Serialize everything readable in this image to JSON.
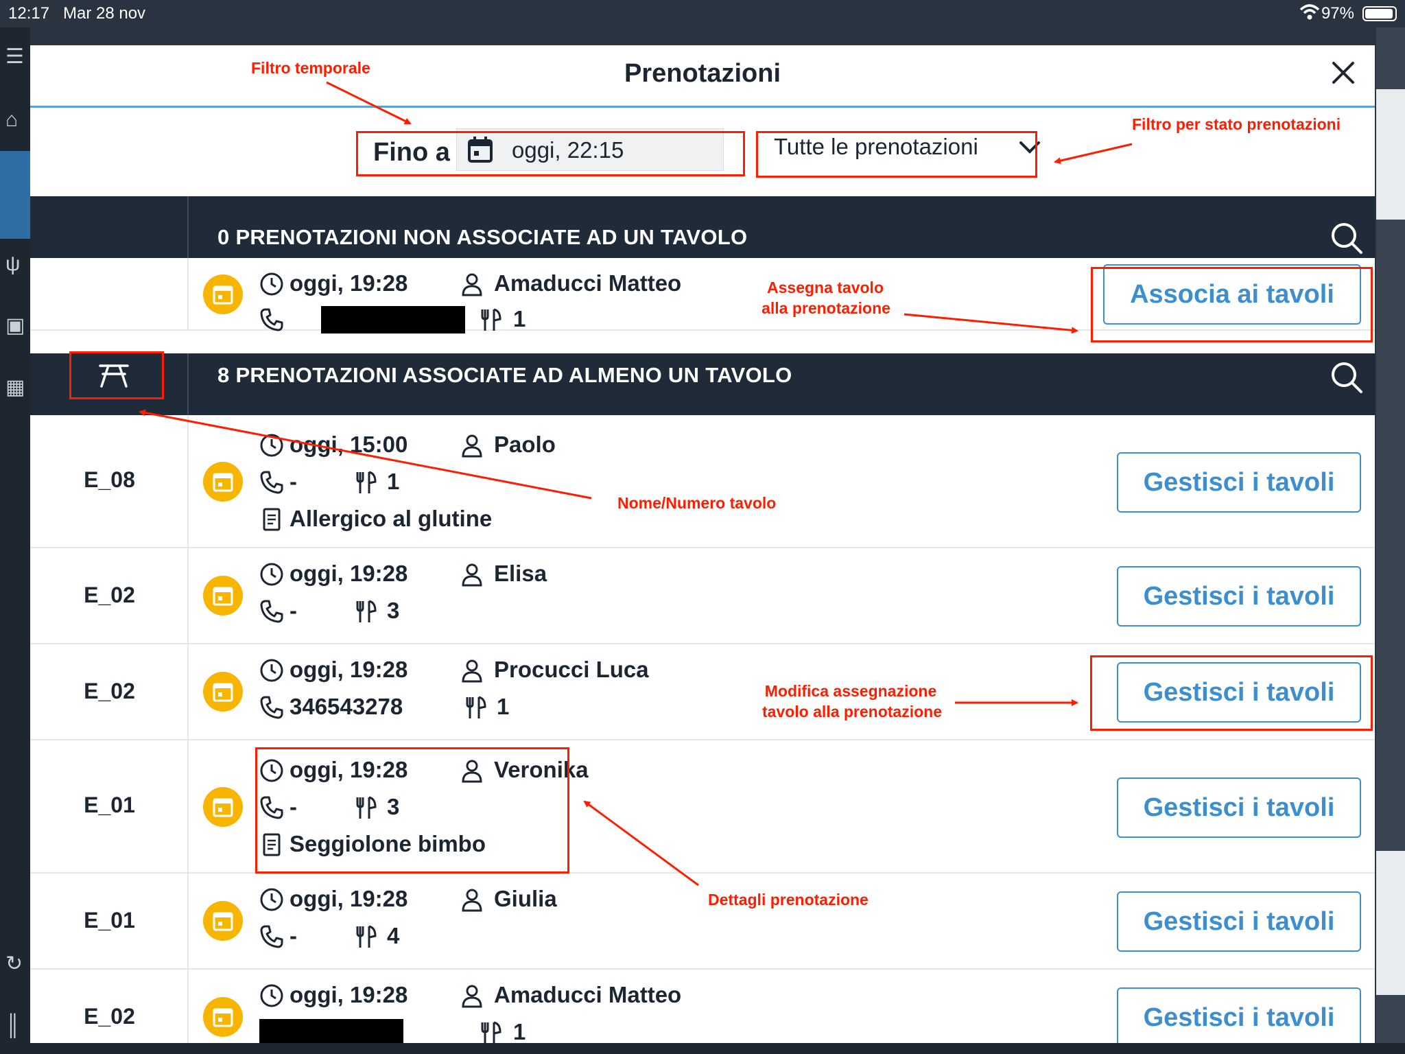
{
  "status_bar": {
    "time": "12:17",
    "date": "Mar 28 nov",
    "battery": "97%"
  },
  "modal": {
    "title": "Prenotazioni"
  },
  "filters": {
    "until_label": "Fino a",
    "date_value": "oggi, 22:15",
    "status_value": "Tutte le prenotazioni"
  },
  "sections": {
    "unassigned_title": "0 PRENOTAZIONI NON ASSOCIATE AD UN TAVOLO",
    "assigned_title": "8 PRENOTAZIONI ASSOCIATE AD ALMENO UN TAVOLO"
  },
  "unassigned": [
    {
      "time": "oggi, 19:28",
      "name": "Amaducci Matteo",
      "phone": "",
      "covers": "1",
      "button": "Associa ai tavoli"
    }
  ],
  "assigned": [
    {
      "table": "E_08",
      "time": "oggi, 15:00",
      "name": "Paolo",
      "phone": "-",
      "covers": "1",
      "note": "Allergico al glutine",
      "button": "Gestisci i tavoli"
    },
    {
      "table": "E_02",
      "time": "oggi, 19:28",
      "name": "Elisa",
      "phone": "-",
      "covers": "3",
      "note": "",
      "button": "Gestisci i tavoli"
    },
    {
      "table": "E_02",
      "time": "oggi, 19:28",
      "name": "Procucci Luca",
      "phone": "346543278",
      "covers": "1",
      "note": "",
      "button": "Gestisci i tavoli"
    },
    {
      "table": "E_01",
      "time": "oggi, 19:28",
      "name": "Veronika",
      "phone": "-",
      "covers": "3",
      "note": "Seggiolone bimbo",
      "button": "Gestisci i tavoli"
    },
    {
      "table": "E_01",
      "time": "oggi, 19:28",
      "name": "Giulia",
      "phone": "-",
      "covers": "4",
      "note": "",
      "button": "Gestisci i tavoli"
    },
    {
      "table": "E_02",
      "time": "oggi, 19:28",
      "name": "Amaducci Matteo",
      "phone": "",
      "covers": "1",
      "note": "",
      "button": "Gestisci i tavoli"
    }
  ],
  "annotations": {
    "time_filter": "Filtro temporale",
    "status_filter": "Filtro per stato prenotazioni",
    "assign_line1": "Assegna tavolo",
    "assign_line2": "alla prenotazione",
    "table_name": "Nome/Numero tavolo",
    "modify_line1": "Modifica assegnazione",
    "modify_line2": "tavolo alla prenotazione",
    "details": "Dettagli prenotazione"
  },
  "colors": {
    "accent": "#3b8fd1",
    "header_dark": "#1f2b38",
    "badge": "#f7b500",
    "annotation": "#ff1d00"
  }
}
